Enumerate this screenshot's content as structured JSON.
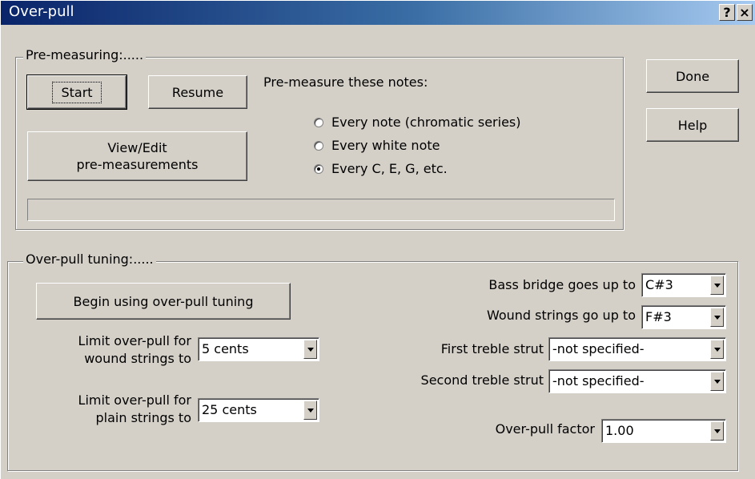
{
  "window": {
    "title": "Over-pull",
    "help_btn": "?",
    "close_btn": "×"
  },
  "premeasure": {
    "legend": "Pre-measuring:.....",
    "start": "Start",
    "resume": "Resume",
    "view_edit_line1": "View/Edit",
    "view_edit_line2": "pre-measurements",
    "notes_label": "Pre-measure these notes:",
    "options": [
      {
        "label": "Every note (chromatic series)",
        "selected": false
      },
      {
        "label": "Every white note",
        "selected": false
      },
      {
        "label": "Every C, E, G, etc.",
        "selected": true
      }
    ],
    "progress": 0
  },
  "side": {
    "done": "Done",
    "help": "Help"
  },
  "overpull": {
    "legend": "Over-pull tuning:.....",
    "begin": "Begin using over-pull tuning",
    "wound_limit_line1": "Limit over-pull for",
    "wound_limit_line2": "wound strings to",
    "wound_limit_value": "5 cents",
    "plain_limit_line1": "Limit over-pull for",
    "plain_limit_line2": "plain strings to",
    "plain_limit_value": "25 cents",
    "bass_bridge_label": "Bass bridge goes up to",
    "bass_bridge_value": "C#3",
    "wound_strings_label": "Wound strings go up to",
    "wound_strings_value": "F#3",
    "first_strut_label": "First treble strut",
    "first_strut_value": "-not specified-",
    "second_strut_label": "Second treble strut",
    "second_strut_value": "-not specified-",
    "factor_label": "Over-pull factor",
    "factor_value": "1.00"
  }
}
